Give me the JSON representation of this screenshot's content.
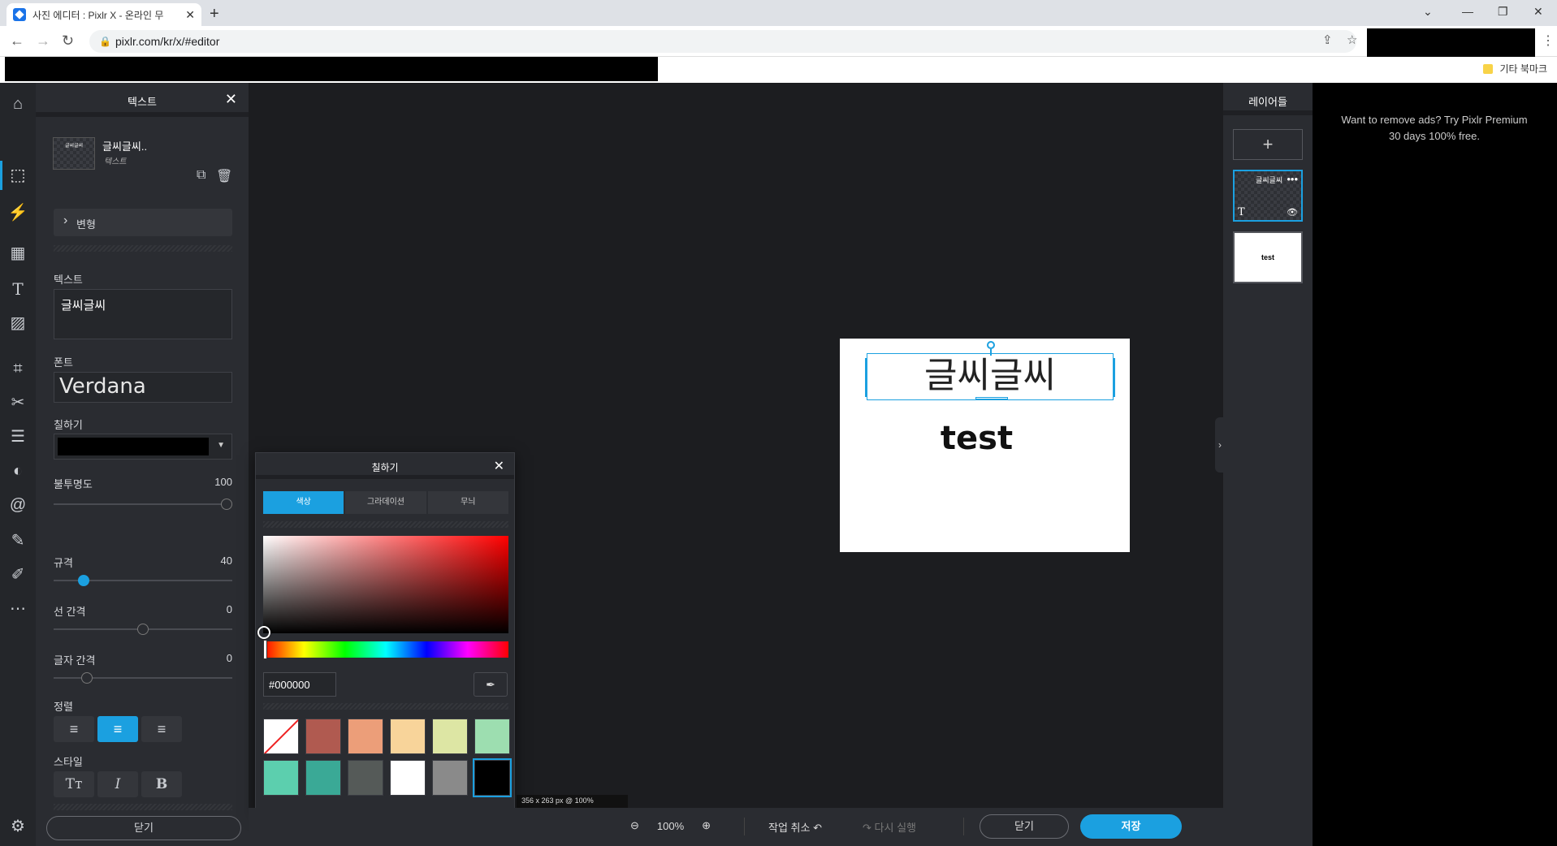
{
  "browser": {
    "tab_title": "사진 에디터 : Pixlr X - 온라인 무",
    "url": "pixlr.com/kr/x/#editor",
    "bookmark_folder": "기타 북마크"
  },
  "left_panel": {
    "title": "텍스트",
    "layer_name": "글씨글씨..",
    "layer_type": "텍스트",
    "layer_thumb_text": "글씨글씨",
    "transform_label": "변형",
    "text_label": "텍스트",
    "text_value": "글씨글씨",
    "font_label": "폰트",
    "font_value": "Verdana",
    "fill_label": "칠하기",
    "opacity_label": "불투명도",
    "opacity_value": "100",
    "size_label": "규격",
    "size_value": "40",
    "line_spacing_label": "선 간격",
    "line_spacing_value": "0",
    "letter_spacing_label": "글자 간격",
    "letter_spacing_value": "0",
    "align_label": "정렬",
    "style_label": "스타일",
    "close_label": "닫기"
  },
  "picker": {
    "title": "칠하기",
    "tabs": [
      "색상",
      "그라데이션",
      "무늬"
    ],
    "hex": "#000000",
    "swatches": [
      "none",
      "#b05a50",
      "#ec9e79",
      "#f8d49a",
      "#dde6a4",
      "#9ddeb0",
      "#5ccfae",
      "#3aa996",
      "#555a58",
      "#ffffff",
      "#8a8a8a",
      "#000000"
    ]
  },
  "canvas": {
    "selected_text": "글씨글씨",
    "text2": "test",
    "size_info": "356 x 263 px @ 100%"
  },
  "layers": {
    "title": "레이어들",
    "layer1_text": "글씨글씨",
    "layer2_text": "test"
  },
  "ad": {
    "text": "Want to remove ads? Try Pixlr Premium 30 days 100% free."
  },
  "bottom": {
    "zoom": "100%",
    "undo": "작업 취소",
    "redo": "다시 실행",
    "close": "닫기",
    "save": "저장"
  },
  "colors": {
    "accent": "#1ba0e0",
    "panel": "#2a2c31",
    "workspace": "#1c1d20"
  }
}
